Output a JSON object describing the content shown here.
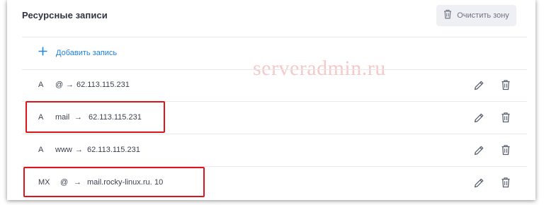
{
  "header": {
    "title": "Ресурсные записи",
    "clear_zone_label": "Очистить зону"
  },
  "add_record": {
    "label": "Добавить запись"
  },
  "records": [
    {
      "type": "A",
      "host": "@",
      "arrow": "→",
      "value": "62.113.115.231",
      "priority": "",
      "highlighted": false
    },
    {
      "type": "A",
      "host": "mail",
      "arrow": "→",
      "value": "62.113.115.231",
      "priority": "",
      "highlighted": true
    },
    {
      "type": "A",
      "host": "www",
      "arrow": "→",
      "value": "62.113.115.231",
      "priority": "",
      "highlighted": false
    },
    {
      "type": "MX",
      "host": "@",
      "arrow": "→",
      "value": "mail.rocky-linux.ru.",
      "priority": "10",
      "highlighted": true
    }
  ],
  "icons": {
    "clear": "trash-icon",
    "add": "plus-icon",
    "edit": "pencil-icon",
    "delete": "trash-icon"
  },
  "watermark": "serveradmin.ru",
  "colors": {
    "accent": "#1e88e5",
    "highlight": "#e0151b",
    "text": "#3b4150",
    "icon": "#5b6170"
  }
}
